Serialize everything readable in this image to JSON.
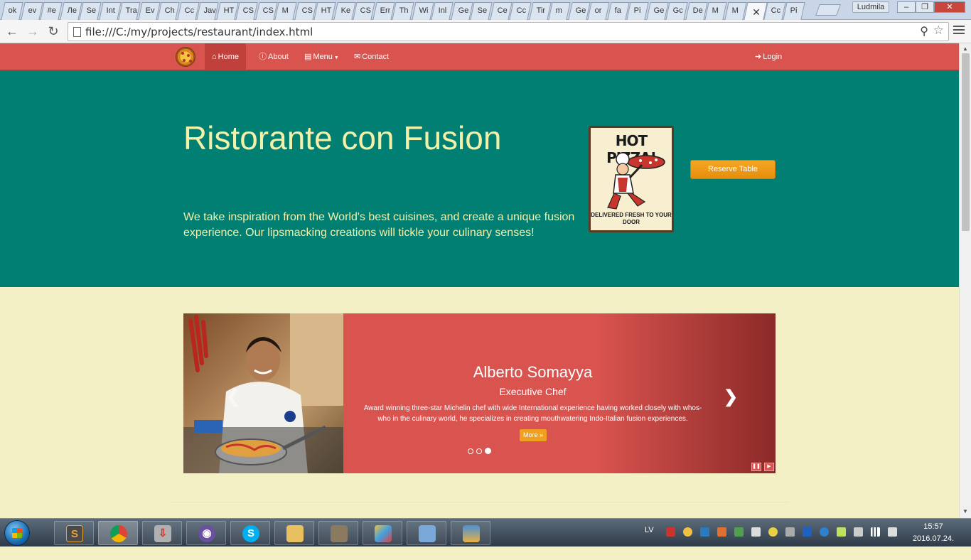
{
  "browser": {
    "tabs": [
      "ok",
      "ev",
      "#e",
      "Ле",
      "Se",
      "Int",
      "Tra",
      "Ev",
      "Ch",
      "Cc",
      "Jav",
      "HT",
      "CS",
      "CS",
      "M",
      "CS",
      "HT",
      "Ke",
      "CS",
      "Err",
      "Th",
      "Wi",
      "Inl",
      "Ge",
      "Se",
      "Ce",
      "Cc",
      "Tir",
      "m",
      "Ge",
      "or",
      "fa",
      "Pi",
      "Ge",
      "Gc",
      "De",
      "M",
      "M",
      "",
      "Cc",
      "Pi"
    ],
    "active_tab_index": 38,
    "user": "Ludmila",
    "url": "file:///C:/my/projects/restaurant/index.html"
  },
  "site": {
    "nav": {
      "home": "Home",
      "about": "About",
      "menu": "Menu",
      "contact": "Contact",
      "login": "Login"
    },
    "jumbotron": {
      "title": "Ristorante con Fusion",
      "lead": "We take inspiration from the World's best cuisines, and create a unique fusion experience. Our lipsmacking creations will tickle your culinary senses!",
      "poster_title": "HOT PIZZA!",
      "poster_subtitle": "DELIVERED FRESH TO YOUR DOOR",
      "reserve_button": "Reserve Table"
    },
    "carousel": {
      "name": "Alberto Somayya",
      "role": "Executive Chef",
      "text": "Award winning three-star Michelin chef with wide International experience having worked closely with whos-who in the culinary world, he specializes in creating mouthwatering Indo-Italian fusion experiences.",
      "more_button": "More »",
      "indicators": 3,
      "active_indicator": 2
    }
  },
  "taskbar": {
    "language": "LV",
    "time": "15:57",
    "date": "2016.07.24."
  },
  "colors": {
    "navbar": "#d9534f",
    "jumbotron": "#017f72",
    "page_bg": "#f4f0c6",
    "accent_text": "#f4f0a8",
    "button": "#f5a623"
  }
}
